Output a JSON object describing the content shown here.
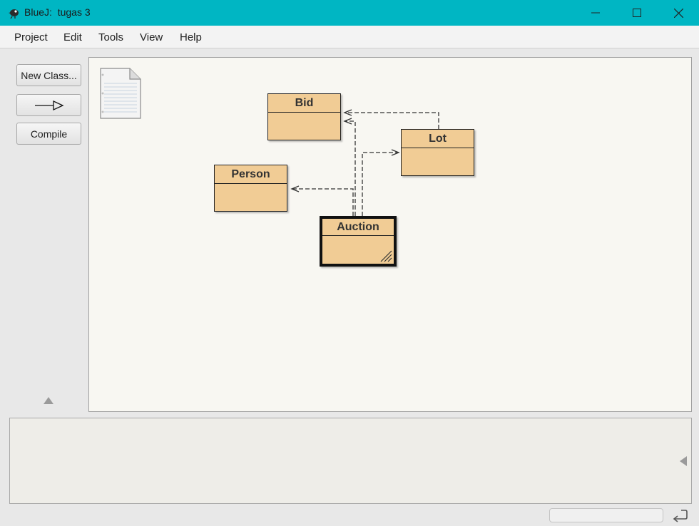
{
  "window": {
    "title": "BlueJ:  tugas 3",
    "controls": [
      "minimize-icon",
      "maximize-icon",
      "close-icon"
    ]
  },
  "menu": {
    "items": [
      "Project",
      "Edit",
      "Tools",
      "View",
      "Help"
    ]
  },
  "toolbar": {
    "new_class_label": "New Class...",
    "inheritance_arrow_icon": "inheritance-arrow-icon",
    "compile_label": "Compile"
  },
  "diagram": {
    "classes": [
      "Bid",
      "Lot",
      "Person",
      "Auction"
    ],
    "selected_class": "Auction",
    "readme_icon": "readme-document-icon",
    "uses_dependencies": [
      {
        "from": "Lot",
        "to": "Bid"
      },
      {
        "from": "Auction",
        "to": "Bid"
      },
      {
        "from": "Auction",
        "to": "Lot"
      },
      {
        "from": "Auction",
        "to": "Person"
      }
    ]
  },
  "colors": {
    "titlebar": "#00b6c3",
    "class_fill": "#f1cc95",
    "canvas_bg": "#f8f7f2"
  }
}
